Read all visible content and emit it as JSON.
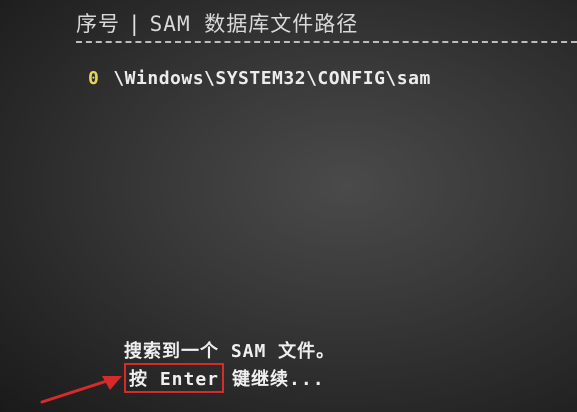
{
  "header": {
    "col_index": "序号",
    "separator": "|",
    "col_path": "SAM 数据库文件路径"
  },
  "entries": [
    {
      "index": "0",
      "path": "\\Windows\\SYSTEM32\\CONFIG\\sam"
    }
  ],
  "message": {
    "found": "搜索到一个 SAM 文件。",
    "press_prefix": "按 Enter",
    "press_suffix": "键继续..."
  },
  "colors": {
    "highlight_box": "#d72b2b",
    "arrow": "#d72b2b",
    "index_text": "#e6d35a"
  },
  "icons": {
    "pointer": "red-arrow-icon"
  }
}
